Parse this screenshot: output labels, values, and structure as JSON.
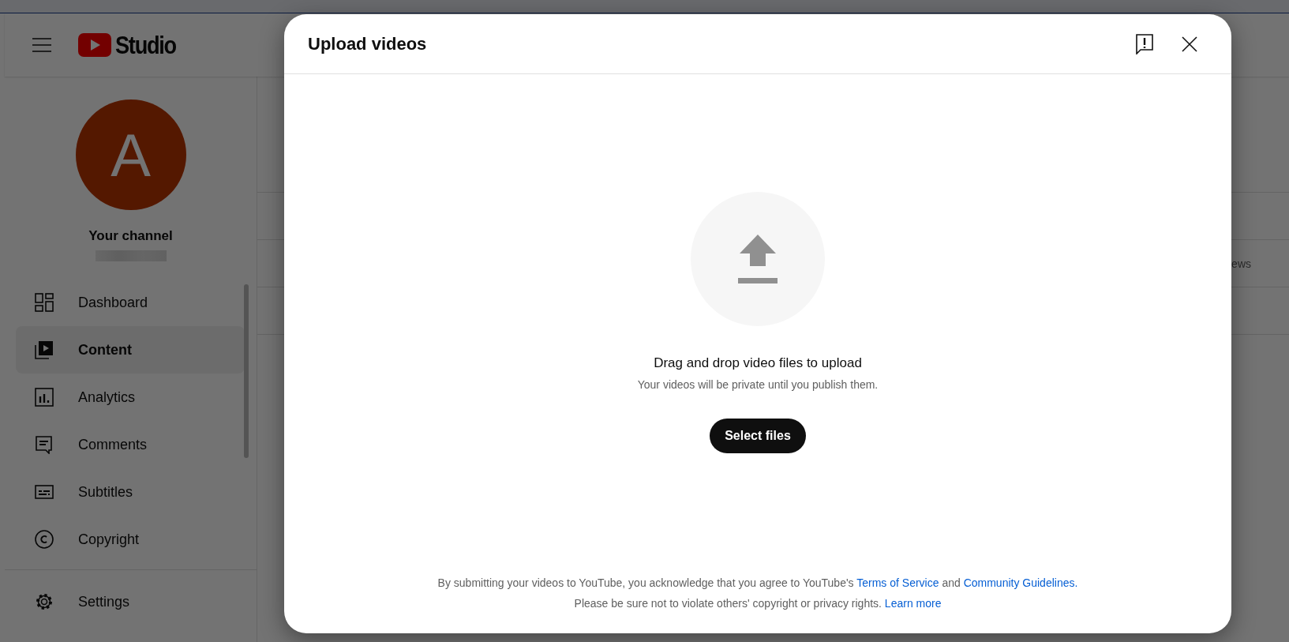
{
  "header": {
    "logo_text": "Studio"
  },
  "channel": {
    "avatar_letter": "A",
    "name": "Your channel"
  },
  "sidebar": {
    "items": [
      {
        "label": "Dashboard",
        "selected": false
      },
      {
        "label": "Content",
        "selected": true
      },
      {
        "label": "Analytics",
        "selected": false
      },
      {
        "label": "Comments",
        "selected": false
      },
      {
        "label": "Subtitles",
        "selected": false
      },
      {
        "label": "Copyright",
        "selected": false
      }
    ],
    "bottom_items": [
      {
        "label": "Settings",
        "selected": false
      }
    ]
  },
  "content_table": {
    "column_header": "ews"
  },
  "dialog": {
    "title": "Upload videos",
    "prompt": "Drag and drop video files to upload",
    "note": "Your videos will be private until you publish them.",
    "button": "Select files",
    "legal": [
      [
        {
          "kind": "text",
          "text": "By submitting your videos to YouTube, you acknowledge that you agree to YouTube's "
        },
        {
          "kind": "link",
          "text": "Terms of Service"
        },
        {
          "kind": "text",
          "text": " and "
        },
        {
          "kind": "link",
          "text": "Community Guidelines."
        }
      ],
      [
        {
          "kind": "text",
          "text": "Please be sure not to violate others' copyright or privacy rights. "
        },
        {
          "kind": "link",
          "text": "Learn more"
        }
      ]
    ]
  }
}
